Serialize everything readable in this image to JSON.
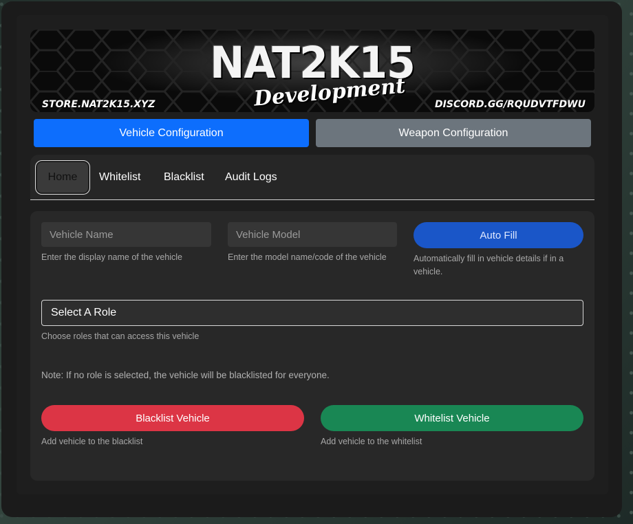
{
  "banner": {
    "logo_main": "NAT2K15",
    "logo_sub": "Development",
    "store_text": "STORE.NAT2K15.XYZ",
    "discord_text": "DISCORD.GG/RQUDVTFDWU"
  },
  "config_tabs": {
    "vehicle": "Vehicle Configuration",
    "weapon": "Weapon Configuration"
  },
  "nav": {
    "home": "Home",
    "whitelist": "Whitelist",
    "blacklist": "Blacklist",
    "audit_logs": "Audit Logs"
  },
  "form": {
    "vehicle_name": {
      "placeholder": "Vehicle Name",
      "value": "",
      "help": "Enter the display name of the vehicle"
    },
    "vehicle_model": {
      "placeholder": "Vehicle Model",
      "value": "",
      "help": "Enter the model name/code of the vehicle"
    },
    "auto_fill": {
      "label": "Auto Fill",
      "help": "Automatically fill in vehicle details if in a vehicle."
    },
    "role_select": {
      "value": "Select A Role",
      "help": "Choose roles that can access this vehicle"
    },
    "note": "Note: If no role is selected, the vehicle will be blacklisted for everyone.",
    "blacklist_button": {
      "label": "Blacklist Vehicle",
      "help": "Add vehicle to the blacklist"
    },
    "whitelist_button": {
      "label": "Whitelist Vehicle",
      "help": "Add vehicle to the whitelist"
    }
  },
  "colors": {
    "primary": "#0d6efd",
    "secondary": "#6c757d",
    "danger": "#dc3545",
    "success": "#198754",
    "autofill": "#1a56c8"
  }
}
